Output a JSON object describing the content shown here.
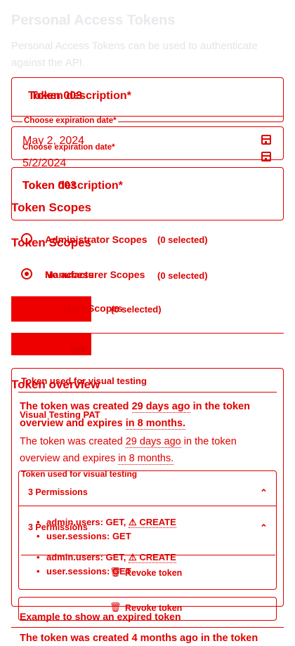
{
  "header": {
    "title": "Personal Access Tokens",
    "subtitle": "Personal Access Tokens can be used to authenticate against the API."
  },
  "form": {
    "description_label": "Token description*",
    "description_value": "Token 003",
    "expiration_label": "Choose expiration date*",
    "expiration_value_1": "May 2, 2024",
    "expiration_value_2": "5/2/2024"
  },
  "scopes": {
    "heading": "Token Scopes",
    "items": [
      {
        "label": "Administrator Scopes",
        "count": "(0 selected)"
      },
      {
        "label": "Manufacturer Scopes",
        "count": "(0 selected)"
      },
      {
        "label": "User Scopes",
        "count": "(0 selected)"
      }
    ],
    "no_access_label": "No access"
  },
  "overview": {
    "heading": "Token overview",
    "tokens": [
      {
        "name": "Token used for visual testing",
        "name_alt": "Visual Testing PAT",
        "desc_pre": "The token was created",
        "created": "29 days ago",
        "desc_mid": "in the token overview and expires",
        "expires": "in 8 months.",
        "permissions_label": "3 Permissions",
        "permissions": [
          {
            "text": "admin.users: GET,",
            "warn": "⚠ CREATE"
          },
          {
            "text": "user.sessions: GET",
            "warn": ""
          }
        ],
        "revoke_label": "Revoke token"
      },
      {
        "name": "Example to show an expired token",
        "desc_pre": "The token was created",
        "created": "4 months ago",
        "desc_mid": "in the token"
      }
    ]
  },
  "colors": {
    "accent": "#e00000",
    "ghost": "#e9e9ee"
  }
}
